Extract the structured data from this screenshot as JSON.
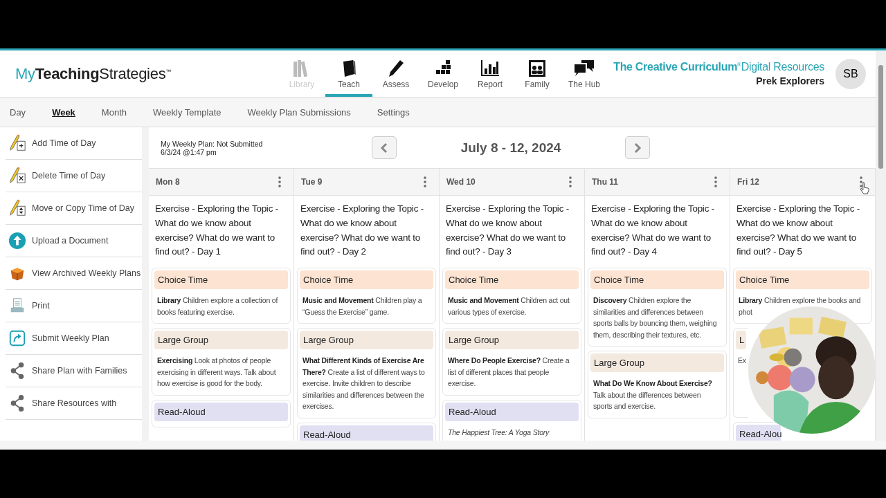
{
  "brand": {
    "logo_light": "My",
    "logo_bold": "Teaching",
    "logo_rest": "Strategies",
    "logo_mark": "™"
  },
  "nav": [
    {
      "label": "Library",
      "selected": false,
      "disabled": true
    },
    {
      "label": "Teach",
      "selected": true,
      "disabled": false
    },
    {
      "label": "Assess",
      "selected": false,
      "disabled": false
    },
    {
      "label": "Develop",
      "selected": false,
      "disabled": false
    },
    {
      "label": "Report",
      "selected": false,
      "disabled": false
    },
    {
      "label": "Family",
      "selected": false,
      "disabled": false
    },
    {
      "label": "The Hub",
      "selected": false,
      "disabled": false
    }
  ],
  "product": {
    "name": "The Creative Curriculum",
    "mark": "®",
    "suffix": "Digital Resources",
    "class_name": "Prek Explorers",
    "avatar": "SB"
  },
  "tabs": [
    {
      "label": "Day",
      "selected": false
    },
    {
      "label": "Week",
      "selected": true
    },
    {
      "label": "Month",
      "selected": false
    },
    {
      "label": "Weekly Template",
      "selected": false
    },
    {
      "label": "Weekly Plan Submissions",
      "selected": false
    },
    {
      "label": "Settings",
      "selected": false
    }
  ],
  "sidebar": {
    "items": [
      {
        "label": "Add Time of Day"
      },
      {
        "label": "Delete Time of Day"
      },
      {
        "label": "Move or Copy Time of Day"
      },
      {
        "label": "Upload a Document"
      },
      {
        "label": "View Archived Weekly Plans"
      },
      {
        "label": "Print"
      },
      {
        "label": "Submit Weekly Plan"
      },
      {
        "label": "Share Plan with Families"
      },
      {
        "label": "Share Resources with"
      }
    ]
  },
  "plan": {
    "status": "My Weekly Plan: Not Submitted",
    "date": "6/3/24 @1:47 pm",
    "range": "July 8 - 12, 2024"
  },
  "days": [
    {
      "label": "Mon 8",
      "topic": "Exercise - Exploring the Topic - What do we know about exercise? What do we want to find out? - Day 1",
      "cards": [
        {
          "kind": "choice",
          "title": "Choice Time",
          "text": "**Library** Children explore a collection of books featuring exercise."
        },
        {
          "kind": "large",
          "title": "Large Group",
          "text": "**Exercising** Look at photos of people exercising in different ways. Talk about how exercise is good for the body."
        },
        {
          "kind": "read",
          "title": "Read-Aloud"
        }
      ]
    },
    {
      "label": "Tue 9",
      "topic": "Exercise - Exploring the Topic - What do we know about exercise? What do we want to find out? - Day 2",
      "cards": [
        {
          "kind": "choice",
          "title": "Choice Time",
          "text": "**Music and Movement** Children play a “Guess the Exercise” game."
        },
        {
          "kind": "large",
          "title": "Large Group",
          "text": "**What Different Kinds of Exercise Are There?** Create a list of different ways to exercise. Invite children to describe similarities and differences between the exercises."
        },
        {
          "kind": "read",
          "title": "Read-Aloud"
        }
      ]
    },
    {
      "label": "Wed 10",
      "topic": "Exercise - Exploring the Topic - What do we know about exercise? What do we want to find out? - Day 3",
      "cards": [
        {
          "kind": "choice",
          "title": "Choice Time",
          "text": "**Music and Movement** Children act out various types of exercise."
        },
        {
          "kind": "large",
          "title": "Large Group",
          "text": "**Where Do People Exercise?** Create a list of different places that people exercise."
        },
        {
          "kind": "read",
          "title": "Read-Aloud",
          "text": "*The Happiest Tree: A Yoga Story*"
        }
      ]
    },
    {
      "label": "Thu 11",
      "topic": "Exercise - Exploring the Topic - What do we know about exercise? What do we want to find out? - Day 4",
      "cards": [
        {
          "kind": "choice",
          "title": "Choice Time",
          "text": "**Discovery** Children explore the similarities and differences between sports balls by bouncing them, weighing them, describing their textures, etc."
        },
        {
          "kind": "large",
          "title": "Large Group",
          "text": "**What Do We Know About Exercise?** Talk about the differences between sports and exercise."
        }
      ]
    },
    {
      "label": "Fri 12",
      "topic": "Exercise - Exploring the Topic - What do we know about exercise? What do we want to find out? - Day 5",
      "cards": [
        {
          "kind": "choice",
          "title": "Choice Time",
          "text": "**Library** Children explore the books and phot"
        },
        {
          "kind": "large",
          "title": "L",
          "text": "Ex"
        },
        {
          "kind": "read",
          "title": "Read-Alou"
        }
      ]
    }
  ]
}
